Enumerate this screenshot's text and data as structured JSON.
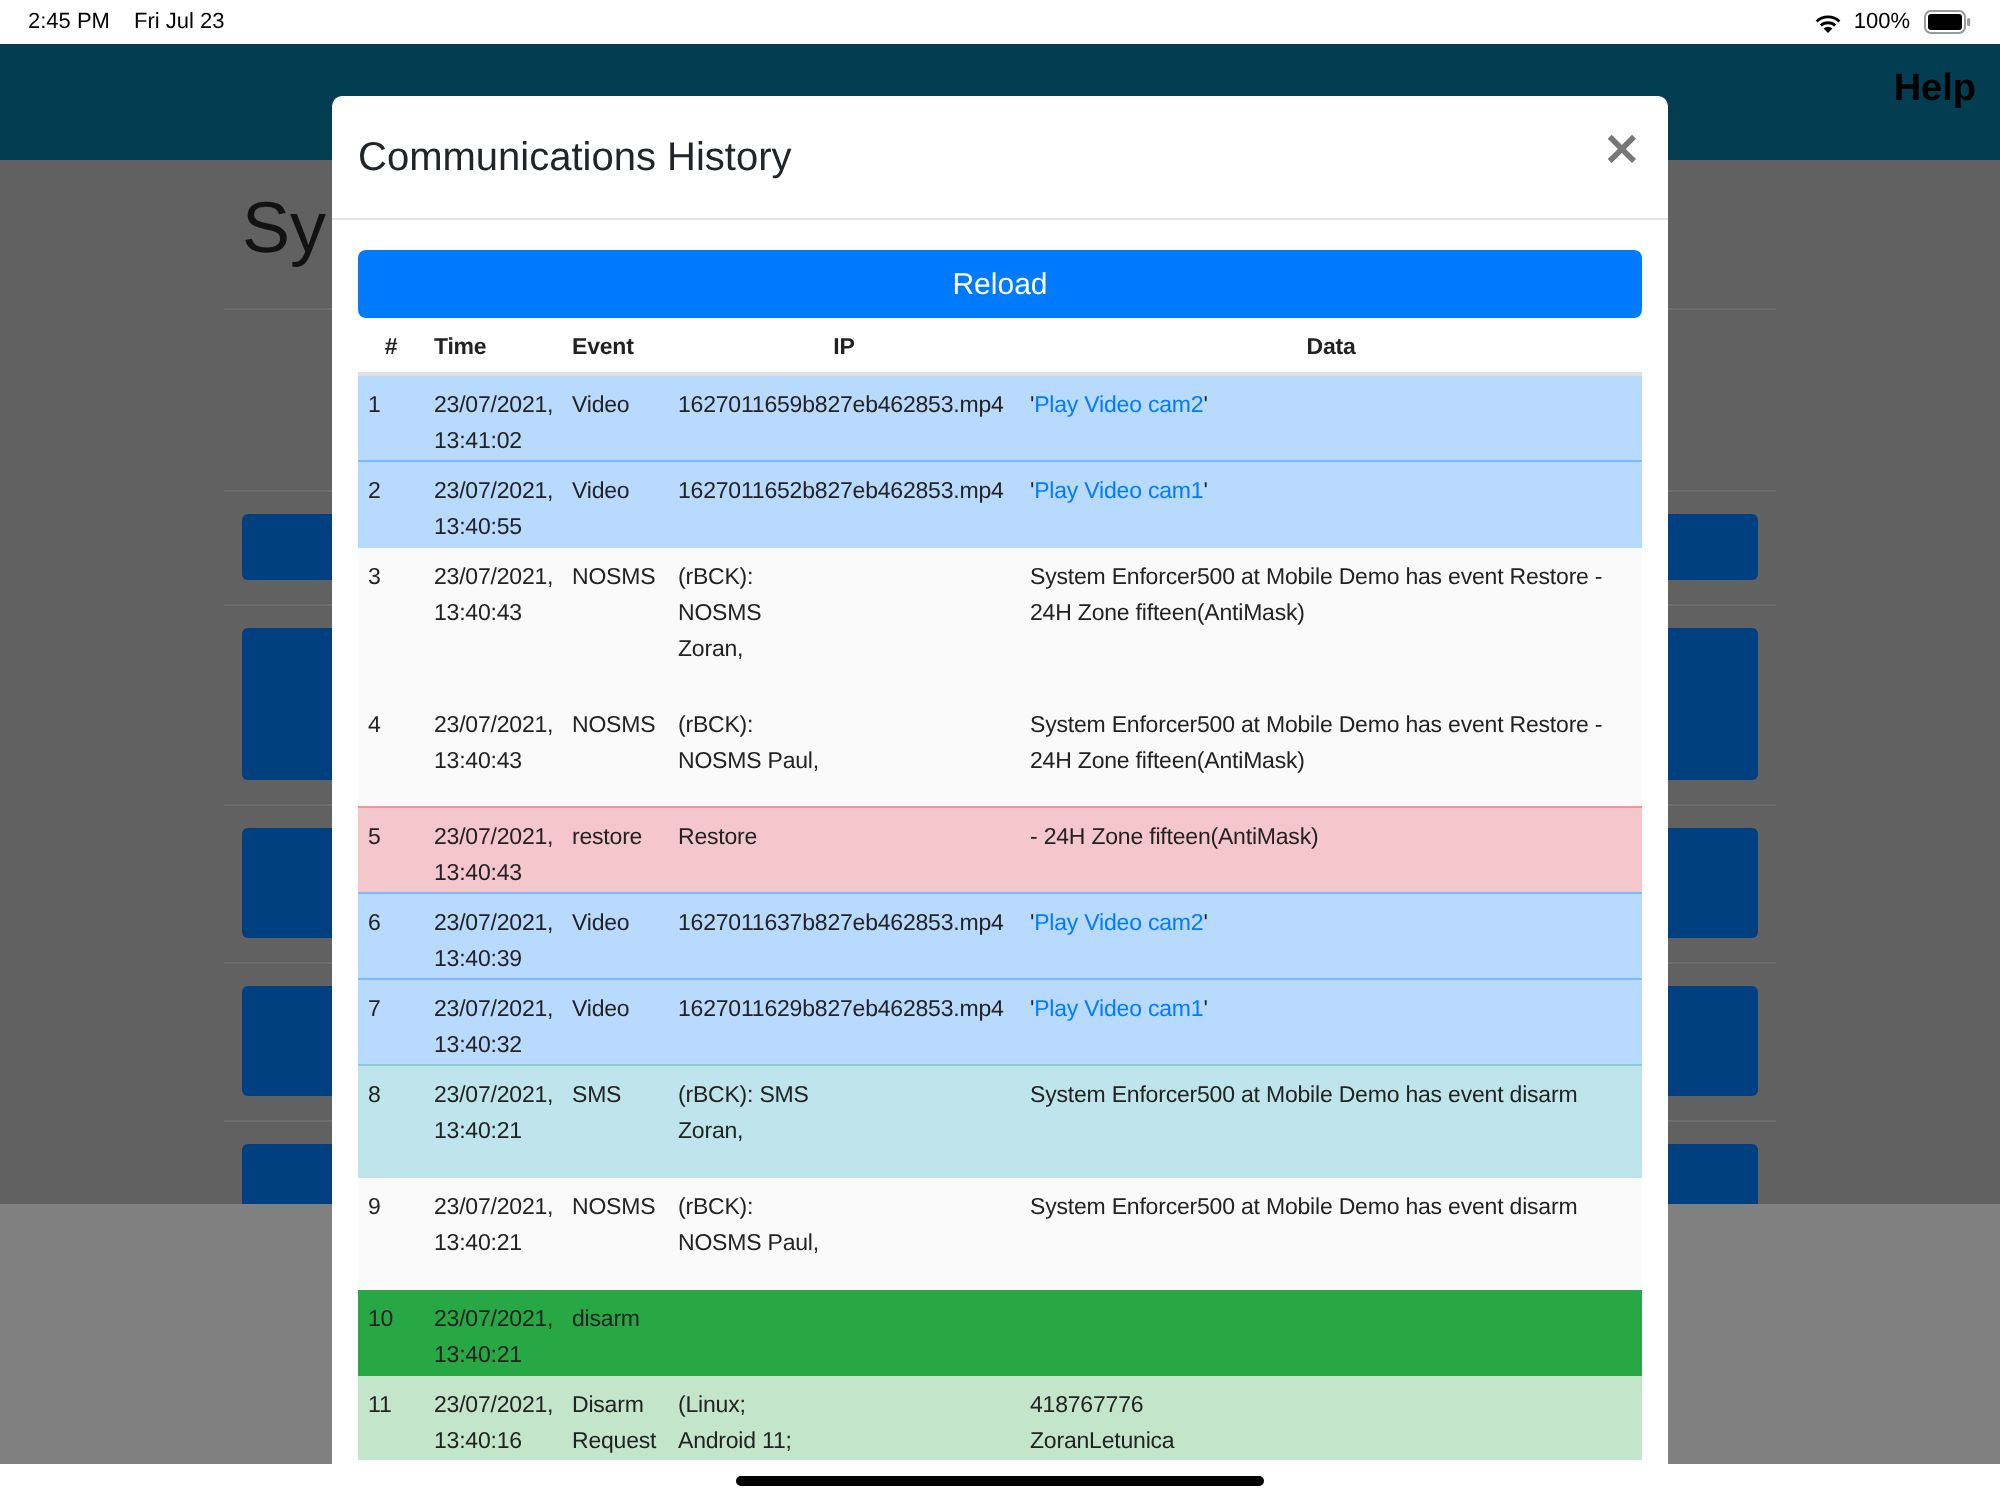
{
  "status_bar": {
    "time": "2:45 PM",
    "date": "Fri Jul 23",
    "battery": "100%"
  },
  "header": {
    "help": "Help"
  },
  "page": {
    "heading": "Sy"
  },
  "modal": {
    "title": "Communications History",
    "close": "×",
    "reload": "Reload",
    "columns": [
      "#",
      "Time",
      "Event",
      "IP",
      "Data"
    ],
    "rows": [
      {
        "kind": "primary",
        "n": "1",
        "time": "23/07/2021,\n13:41:02",
        "event": "Video",
        "ip": "1627011659b827eb462853.mp4",
        "data": [
          {
            "text": "'"
          },
          {
            "text": "Play Video cam2",
            "link": true
          },
          {
            "text": "'"
          }
        ]
      },
      {
        "kind": "primary",
        "n": "2",
        "time": "23/07/2021,\n13:40:55",
        "event": "Video",
        "ip": "1627011652b827eb462853.mp4",
        "data": [
          {
            "text": "'"
          },
          {
            "text": "Play Video cam1",
            "link": true
          },
          {
            "text": "'"
          }
        ]
      },
      {
        "kind": "plain",
        "n": "3",
        "time": "23/07/2021,\n13:40:43",
        "event": "NOSMS",
        "ip": "(rBCK):\nNOSMS\nZoran,",
        "data": [
          {
            "text": "System Enforcer500 at Mobile Demo has event Restore -\n24H Zone fifteen(AntiMask)"
          }
        ]
      },
      {
        "kind": "plain",
        "n": "4",
        "time": "23/07/2021,\n13:40:43",
        "event": "NOSMS",
        "ip": "(rBCK):\nNOSMS Paul,",
        "data": [
          {
            "text": "System Enforcer500 at Mobile Demo has event Restore -\n24H Zone fifteen(AntiMask)"
          }
        ]
      },
      {
        "kind": "danger",
        "n": "5",
        "time": "23/07/2021,\n13:40:43",
        "event": "restore",
        "ip": "Restore",
        "data": [
          {
            "text": "- 24H Zone fifteen(AntiMask)"
          }
        ]
      },
      {
        "kind": "primary",
        "n": "6",
        "time": "23/07/2021,\n13:40:39",
        "event": "Video",
        "ip": "1627011637b827eb462853.mp4",
        "data": [
          {
            "text": "'"
          },
          {
            "text": "Play Video cam2",
            "link": true
          },
          {
            "text": "'"
          }
        ]
      },
      {
        "kind": "primary",
        "n": "7",
        "time": "23/07/2021,\n13:40:32",
        "event": "Video",
        "ip": "1627011629b827eb462853.mp4",
        "data": [
          {
            "text": "'"
          },
          {
            "text": "Play Video cam1",
            "link": true
          },
          {
            "text": "'"
          }
        ]
      },
      {
        "kind": "info",
        "n": "8",
        "time": "23/07/2021,\n13:40:21",
        "event": "SMS",
        "ip": "(rBCK): SMS\nZoran,",
        "data": [
          {
            "text": "System Enforcer500 at Mobile Demo has event disarm"
          }
        ]
      },
      {
        "kind": "plain",
        "n": "9",
        "time": "23/07/2021,\n13:40:21",
        "event": "NOSMS",
        "ip": "(rBCK):\nNOSMS Paul,",
        "data": [
          {
            "text": "System Enforcer500 at Mobile Demo has event disarm"
          }
        ]
      },
      {
        "kind": "success",
        "n": "10",
        "time": "23/07/2021,\n13:40:21",
        "event": "disarm"
      },
      {
        "kind": "success-light",
        "n": "11",
        "time": "23/07/2021,\n13:40:16",
        "event": "Disarm\nRequest",
        "ip": "(Linux;\nAndroid 11;",
        "data": [
          {
            "text": "418767776\nZoranLetunica"
          }
        ]
      }
    ]
  }
}
